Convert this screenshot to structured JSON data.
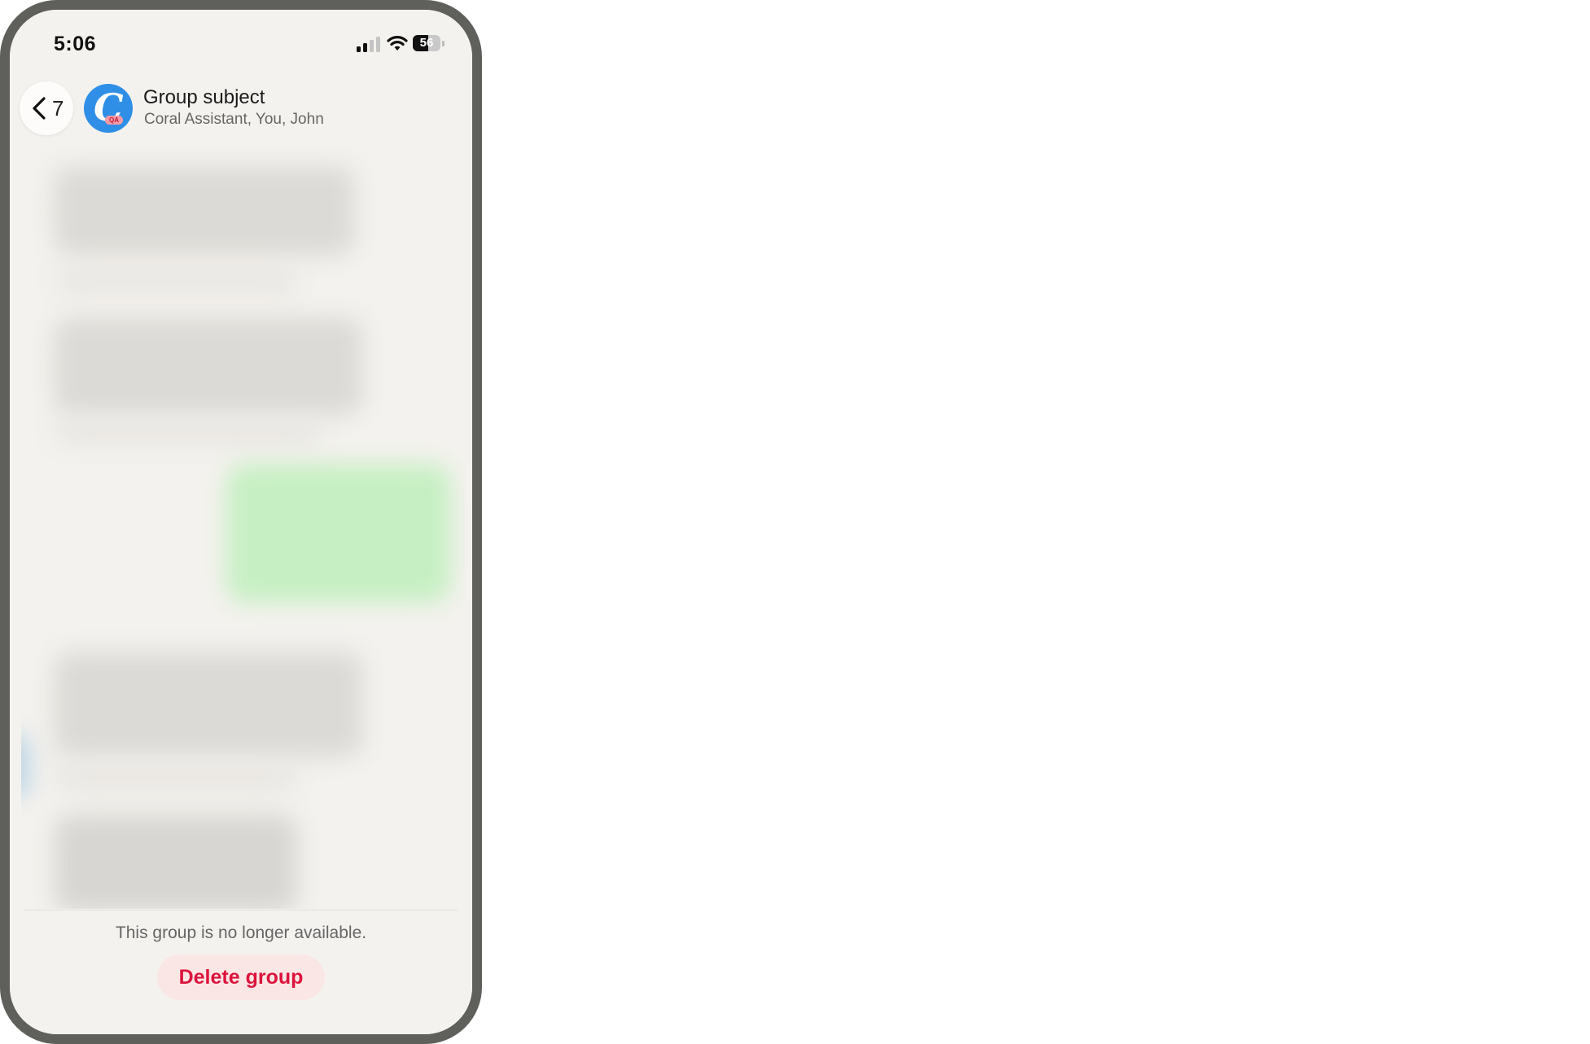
{
  "status_bar": {
    "time": "5:06",
    "battery_percent": "56",
    "battery_level": 0.56,
    "signal_bars": 2
  },
  "header": {
    "back_count": "7",
    "avatar_letter": "C",
    "avatar_badge": "QA",
    "title": "Group subject",
    "members": "Coral Assistant, You, John"
  },
  "footer": {
    "notice": "This group is no longer available.",
    "delete_label": "Delete group"
  },
  "colors": {
    "accent_delete": "#dc143c",
    "avatar_bg": "#2f8fe6",
    "outgoing_bubble": "#c8f2c6"
  }
}
